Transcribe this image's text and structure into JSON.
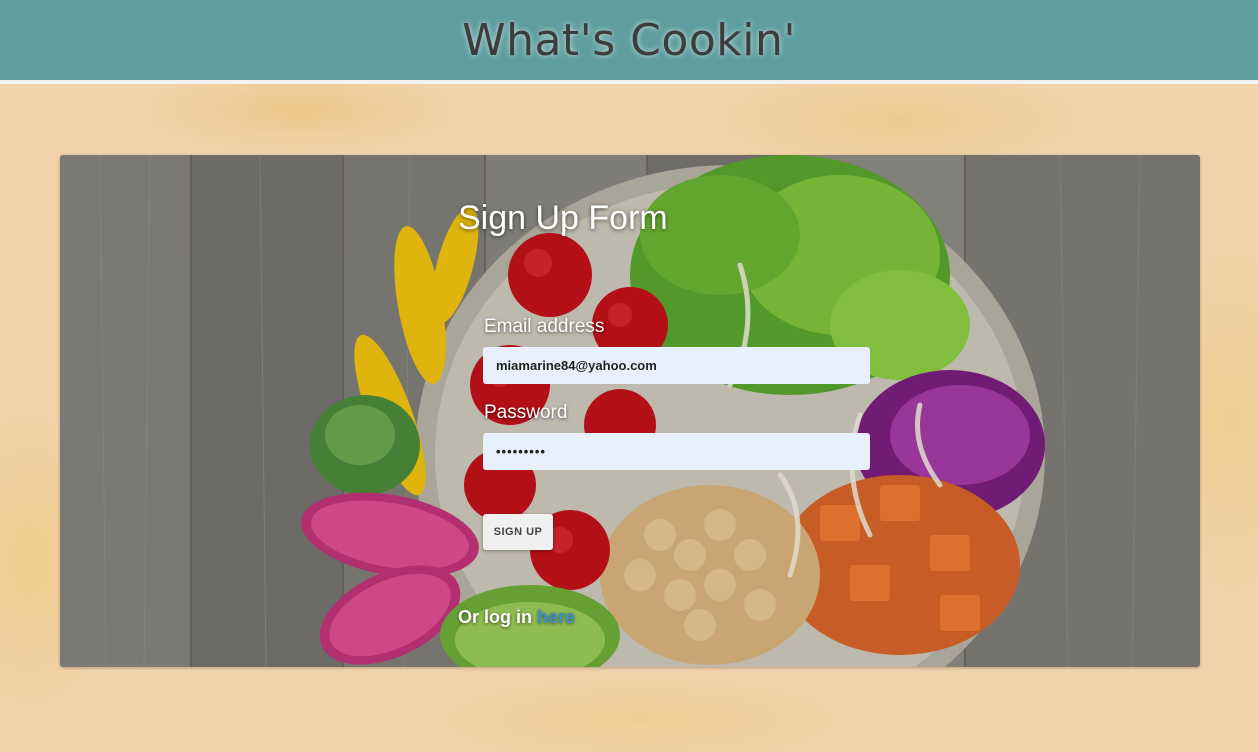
{
  "header": {
    "title": "What's Cookin'"
  },
  "form": {
    "title": "Sign Up Form",
    "email_label": "Email address",
    "email_value": "miamarine84@yahoo.com",
    "password_label": "Password",
    "password_value": "•••••••••",
    "submit_label": "SIGN UP",
    "login_prefix": "Or log in",
    "login_link": "here"
  },
  "colors": {
    "header_bg": "#5e9e9f",
    "input_bg": "#e8f0fe",
    "link": "#3b8fd1"
  }
}
